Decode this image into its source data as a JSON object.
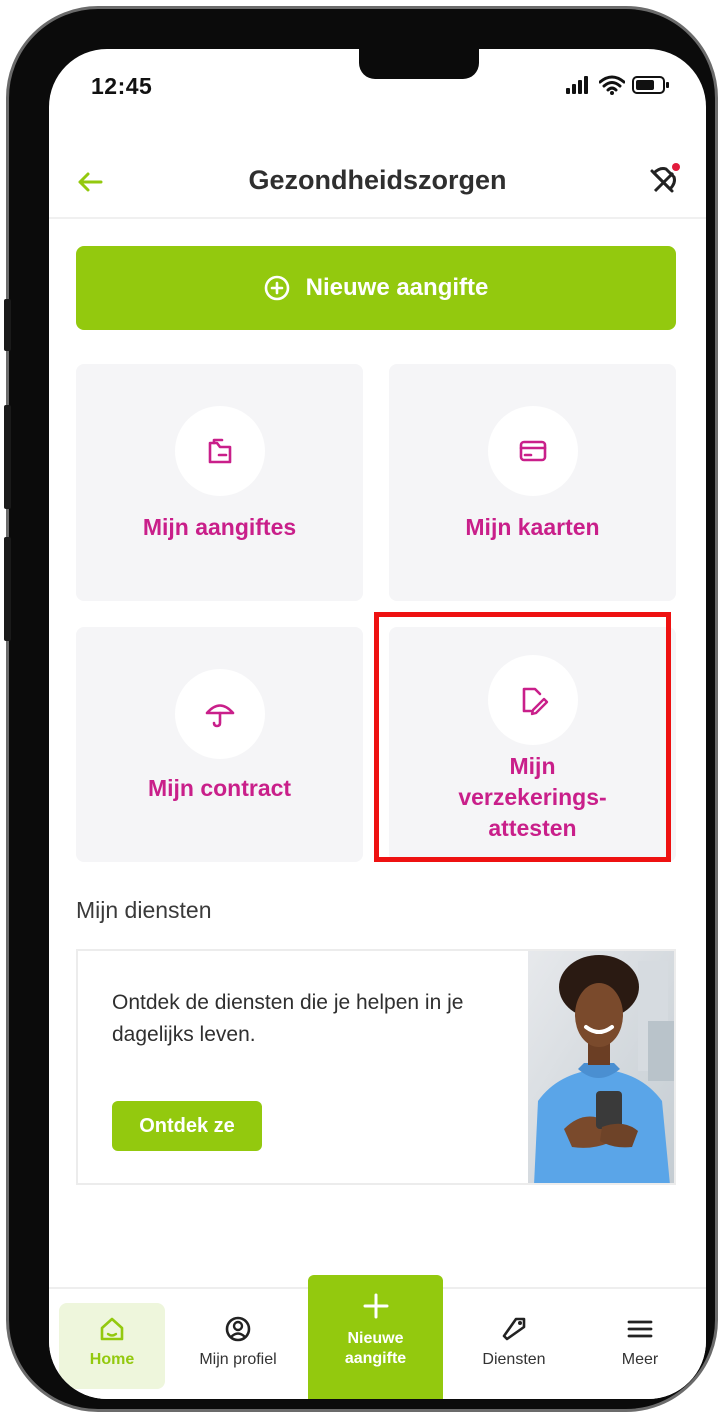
{
  "status_bar": {
    "time": "12:45"
  },
  "header": {
    "title": "Gezondheidszorgen"
  },
  "new_declaration": {
    "label": "Nieuwe aangifte"
  },
  "tiles": [
    {
      "label": "Mijn aangiftes",
      "icon": "declarations-icon"
    },
    {
      "label": "Mijn kaarten",
      "icon": "card-icon"
    },
    {
      "label": "Mijn contract",
      "icon": "umbrella-icon"
    },
    {
      "label_lines": [
        "Mijn",
        "verzekerings-",
        "attesten"
      ],
      "icon": "certificate-icon"
    }
  ],
  "services": {
    "section_title": "Mijn diensten",
    "description": "Ontdek de diensten die je helpen in je dagelijks leven.",
    "button_label": "Ontdek ze"
  },
  "bottom_nav": {
    "items": [
      {
        "label": "Home",
        "icon": "home-icon",
        "active": true
      },
      {
        "label": "Mijn profiel",
        "icon": "profile-icon"
      },
      {
        "label_lines": [
          "Nieuwe",
          "aangifte"
        ],
        "icon": "plus-icon"
      },
      {
        "label": "Diensten",
        "icon": "tag-icon"
      },
      {
        "label": "Meer",
        "icon": "menu-icon"
      }
    ]
  },
  "colors": {
    "brand_green": "#93c90e",
    "accent_magenta": "#c91f8a",
    "highlight_red": "#ee1111",
    "tile_bg": "#f5f5f7"
  }
}
